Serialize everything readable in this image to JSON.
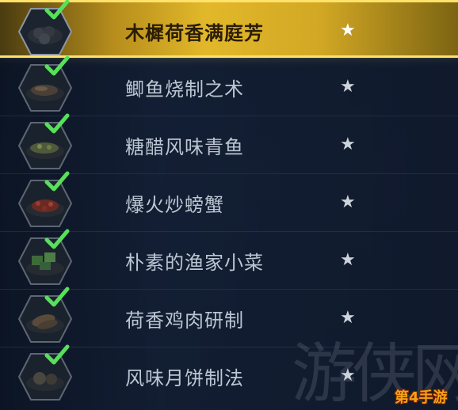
{
  "recipes": [
    {
      "name": "木樨荷香满庭芳",
      "star": "★",
      "completed": true,
      "selected": true
    },
    {
      "name": "鲫鱼烧制之术",
      "star": "★",
      "completed": true,
      "selected": false
    },
    {
      "name": "糖醋风味青鱼",
      "star": "★",
      "completed": true,
      "selected": false
    },
    {
      "name": "爆火炒螃蟹",
      "star": "★",
      "completed": true,
      "selected": false
    },
    {
      "name": "朴素的渔家小菜",
      "star": "★",
      "completed": true,
      "selected": false
    },
    {
      "name": "荷香鸡肉研制",
      "star": "★",
      "completed": true,
      "selected": false
    },
    {
      "name": "风味月饼制法",
      "star": "★",
      "completed": true,
      "selected": false
    }
  ],
  "watermark": {
    "glyph": "游侠网",
    "site": "第4手游"
  },
  "colors": {
    "selected_gold": "#e2b82a",
    "check_green": "#57e05a",
    "text_gray": "#bcc6d2",
    "panel_bg": "#0d1628"
  },
  "icons": {
    "check": "check-icon",
    "star": "star-icon"
  }
}
